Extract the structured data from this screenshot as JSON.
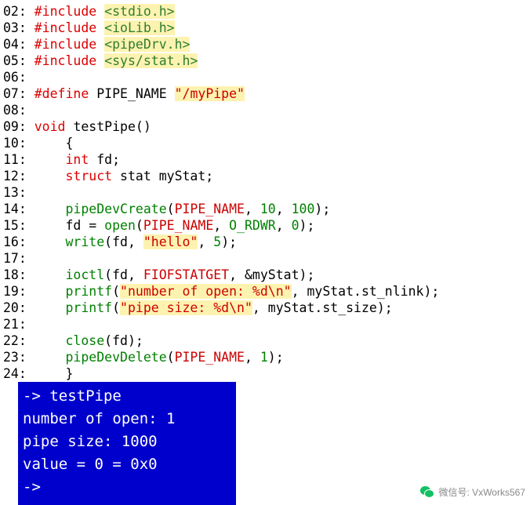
{
  "document": {
    "type": "code-listing",
    "language": "c",
    "lines": [
      {
        "no": "02:",
        "tokens": [
          {
            "t": " ",
            "c": "plain"
          },
          {
            "t": "#include",
            "c": "kw"
          },
          {
            "t": " ",
            "c": "plain"
          },
          {
            "t": "<stdio.h>",
            "c": "str",
            "hl": true
          }
        ]
      },
      {
        "no": "03:",
        "tokens": [
          {
            "t": " ",
            "c": "plain"
          },
          {
            "t": "#include",
            "c": "kw"
          },
          {
            "t": " ",
            "c": "plain"
          },
          {
            "t": "<ioLib.h>",
            "c": "str",
            "hl": true
          }
        ]
      },
      {
        "no": "04:",
        "tokens": [
          {
            "t": " ",
            "c": "plain"
          },
          {
            "t": "#include",
            "c": "kw"
          },
          {
            "t": " ",
            "c": "plain"
          },
          {
            "t": "<pipeDrv.h>",
            "c": "str",
            "hl": true
          }
        ]
      },
      {
        "no": "05:",
        "tokens": [
          {
            "t": " ",
            "c": "plain"
          },
          {
            "t": "#include",
            "c": "kw"
          },
          {
            "t": " ",
            "c": "plain"
          },
          {
            "t": "<sys/stat.h>",
            "c": "str",
            "hl": true
          }
        ]
      },
      {
        "no": "06:",
        "tokens": []
      },
      {
        "no": "07:",
        "tokens": [
          {
            "t": " ",
            "c": "plain"
          },
          {
            "t": "#define",
            "c": "kw"
          },
          {
            "t": " PIPE_NAME ",
            "c": "plain"
          },
          {
            "t": "\"/myPipe\"",
            "c": "darkred",
            "hl": true
          }
        ]
      },
      {
        "no": "08:",
        "tokens": []
      },
      {
        "no": "09:",
        "tokens": [
          {
            "t": " ",
            "c": "plain"
          },
          {
            "t": "void",
            "c": "kw"
          },
          {
            "t": " ",
            "c": "plain"
          },
          {
            "t": "testPipe",
            "c": "plain"
          },
          {
            "t": "()",
            "c": "plain"
          }
        ]
      },
      {
        "no": "10:",
        "tokens": [
          {
            "t": "     {",
            "c": "plain"
          }
        ]
      },
      {
        "no": "11:",
        "tokens": [
          {
            "t": "     ",
            "c": "plain"
          },
          {
            "t": "int",
            "c": "kw"
          },
          {
            "t": " fd;",
            "c": "plain"
          }
        ]
      },
      {
        "no": "12:",
        "tokens": [
          {
            "t": "     ",
            "c": "plain"
          },
          {
            "t": "struct",
            "c": "kw"
          },
          {
            "t": " stat myStat;",
            "c": "plain"
          }
        ]
      },
      {
        "no": "13:",
        "tokens": []
      },
      {
        "no": "14:",
        "tokens": [
          {
            "t": "     ",
            "c": "plain"
          },
          {
            "t": "pipeDevCreate",
            "c": "green"
          },
          {
            "t": "(",
            "c": "plain"
          },
          {
            "t": "PIPE_NAME",
            "c": "darkred"
          },
          {
            "t": ", ",
            "c": "plain"
          },
          {
            "t": "10",
            "c": "green"
          },
          {
            "t": ", ",
            "c": "plain"
          },
          {
            "t": "100",
            "c": "green"
          },
          {
            "t": ");",
            "c": "plain"
          }
        ]
      },
      {
        "no": "15:",
        "tokens": [
          {
            "t": "     fd = ",
            "c": "plain"
          },
          {
            "t": "open",
            "c": "green"
          },
          {
            "t": "(",
            "c": "plain"
          },
          {
            "t": "PIPE_NAME",
            "c": "darkred"
          },
          {
            "t": ", ",
            "c": "plain"
          },
          {
            "t": "O_RDWR",
            "c": "green"
          },
          {
            "t": ", ",
            "c": "plain"
          },
          {
            "t": "0",
            "c": "green"
          },
          {
            "t": ");",
            "c": "plain"
          }
        ]
      },
      {
        "no": "16:",
        "tokens": [
          {
            "t": "     ",
            "c": "plain"
          },
          {
            "t": "write",
            "c": "green"
          },
          {
            "t": "(fd, ",
            "c": "plain"
          },
          {
            "t": "\"hello\"",
            "c": "darkred",
            "hl": true
          },
          {
            "t": ", ",
            "c": "plain"
          },
          {
            "t": "5",
            "c": "green"
          },
          {
            "t": ");",
            "c": "plain"
          }
        ]
      },
      {
        "no": "17:",
        "tokens": []
      },
      {
        "no": "18:",
        "tokens": [
          {
            "t": "     ",
            "c": "plain"
          },
          {
            "t": "ioctl",
            "c": "green"
          },
          {
            "t": "(fd, ",
            "c": "plain"
          },
          {
            "t": "FIOFSTATGET",
            "c": "darkred"
          },
          {
            "t": ", &myStat);",
            "c": "plain"
          }
        ]
      },
      {
        "no": "19:",
        "tokens": [
          {
            "t": "     ",
            "c": "plain"
          },
          {
            "t": "printf",
            "c": "green"
          },
          {
            "t": "(",
            "c": "plain"
          },
          {
            "t": "\"number of open: %d\\n\"",
            "c": "darkred",
            "hl": true
          },
          {
            "t": ", myStat.st_nlink);",
            "c": "plain"
          }
        ]
      },
      {
        "no": "20:",
        "tokens": [
          {
            "t": "     ",
            "c": "plain"
          },
          {
            "t": "printf",
            "c": "green"
          },
          {
            "t": "(",
            "c": "plain"
          },
          {
            "t": "\"pipe size: %d\\n\"",
            "c": "darkred",
            "hl": true
          },
          {
            "t": ", myStat.st_size);",
            "c": "plain"
          }
        ]
      },
      {
        "no": "21:",
        "tokens": []
      },
      {
        "no": "22:",
        "tokens": [
          {
            "t": "     ",
            "c": "plain"
          },
          {
            "t": "close",
            "c": "green"
          },
          {
            "t": "(fd);",
            "c": "plain"
          }
        ]
      },
      {
        "no": "23:",
        "tokens": [
          {
            "t": "     ",
            "c": "plain"
          },
          {
            "t": "pipeDevDelete",
            "c": "green"
          },
          {
            "t": "(",
            "c": "plain"
          },
          {
            "t": "PIPE_NAME",
            "c": "darkred"
          },
          {
            "t": ", ",
            "c": "plain"
          },
          {
            "t": "1",
            "c": "green"
          },
          {
            "t": ");",
            "c": "plain"
          }
        ]
      },
      {
        "no": "24:",
        "tokens": [
          {
            "t": "     }",
            "c": "plain"
          }
        ]
      }
    ]
  },
  "terminal": {
    "lines": [
      "-> testPipe",
      "number of open: 1",
      "pipe size: 1000",
      "value = 0 = 0x0",
      "->"
    ]
  },
  "footer": {
    "icon": "wechat-icon",
    "text": "微信号: VxWorks567"
  }
}
